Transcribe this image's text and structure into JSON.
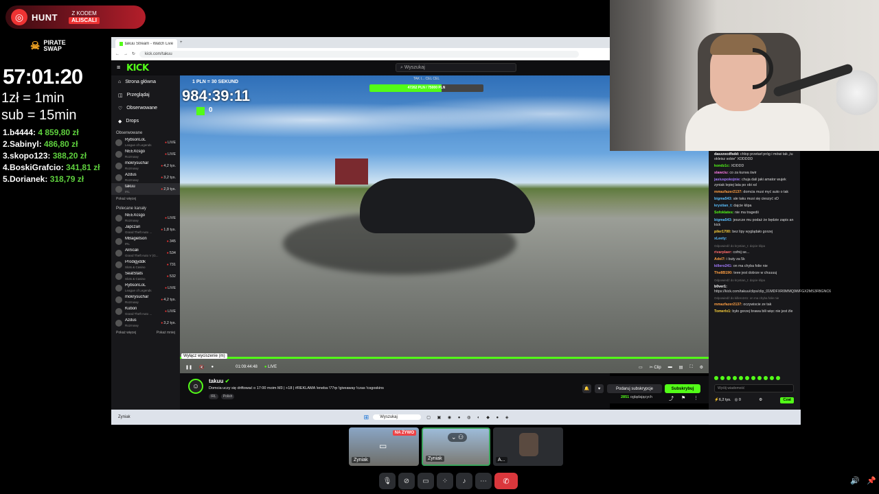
{
  "overlay": {
    "sponsor": {
      "brand": "HUNT",
      "code_label": "Z KODEM",
      "code": "ALISCALI"
    },
    "pirate_brand": "PIRATE SWAP",
    "timer": "57:01:20",
    "rate1": "1zł = 1min",
    "rate2": "sub = 15min",
    "leaderboard": [
      {
        "name": "1.b4444:",
        "amount": "4 859,80 zł"
      },
      {
        "name": "2.Sabinyl:",
        "amount": "486,80 zł"
      },
      {
        "name": "3.skopo123:",
        "amount": "388,20 zł"
      },
      {
        "name": "4.BoskiGrafcio:",
        "amount": "341,81 zł"
      },
      {
        "name": "5.Dorianek:",
        "amount": "318,79 zł"
      }
    ]
  },
  "browser": {
    "tab_title": "takuu Stream - Watch Live on Kick",
    "url": "kick.com/takuu",
    "logo": "KICK",
    "search_placeholder": "Wyszukaj",
    "nav": [
      {
        "icon": "home-icon",
        "label": "Strona główna"
      },
      {
        "icon": "browse-icon",
        "label": "Przeglądaj"
      },
      {
        "icon": "heart-icon",
        "label": "Obserwowane"
      },
      {
        "icon": "drops-icon",
        "label": "Drops"
      }
    ],
    "followed_header": "Obserwowane",
    "followed": [
      {
        "name": "RybsonLoL",
        "cat": "League of Legends",
        "viewers": "LIVE"
      },
      {
        "name": "NEEXcsgo",
        "cat": "Rozmowy",
        "viewers": "LIVE"
      },
      {
        "name": "mokrysuchar",
        "cat": "Rozmowy",
        "viewers": "4,2 tys."
      },
      {
        "name": "Azdus",
        "cat": "Rozmowy",
        "viewers": "3,2 tys."
      },
      {
        "name": "takuu",
        "cat": "IRL",
        "viewers": "2,9 tys."
      }
    ],
    "show_more": "Pokaż więcej",
    "recommended_header": "Polecane kanały",
    "recommended": [
      {
        "name": "NEEXcsgo",
        "cat": "Rozmowy",
        "viewers": "LIVE"
      },
      {
        "name": "Japczan",
        "cat": "Grand Theft Auto ...",
        "viewers": "1,8 tys."
      },
      {
        "name": "MBagietson",
        "cat": "IRL",
        "viewers": "345"
      },
      {
        "name": "AliScali",
        "cat": "Grand Theft Auto V (G...",
        "viewers": "534"
      },
      {
        "name": "Prodigyddk",
        "cat": "Slots & Casino",
        "viewers": "731"
      },
      {
        "name": "SeatStats",
        "cat": "Slots & Casino",
        "viewers": "532"
      },
      {
        "name": "RybsonLoL",
        "cat": "League of Legends",
        "viewers": "LIVE"
      },
      {
        "name": "mokrysuchar",
        "cat": "Rozmowy",
        "viewers": "4,2 tys."
      },
      {
        "name": "Kubon",
        "cat": "Grand Theft Auto ...",
        "viewers": "LIVE"
      },
      {
        "name": "Azdus",
        "cat": "Rozmowy",
        "viewers": "3,2 tys."
      }
    ],
    "show_more2": "Pokaż więcej",
    "show_less": "Pokaż mniej"
  },
  "video": {
    "pln_label": "1 PLN = 30 SEKUND",
    "big_timer": "984:39:11",
    "goal_header": "TAK I... CEL CEL",
    "goal_text": "47262 PLN / 75000 PLN",
    "goal_progress": 0.63,
    "green_counter": "0",
    "tooltip": "Wyłącz wyciszenie (m)",
    "elapsed": "01:09:44:48",
    "live_label": "LIVE",
    "clip_label": "Clip"
  },
  "stream": {
    "name": "takuu",
    "title": "Domcia uczy się driftować o 17:00 moim M3 | +18 | #REKLAMA !eneba !77rp !giveaway !czas !csgoskins",
    "tags": [
      "IRL",
      "Polish"
    ],
    "gift_label": "Podaruj subskrypcje",
    "subscribe_label": "Subskrybuj",
    "viewers_count": "2851",
    "viewers_label": "oglądających",
    "live_badge": "LIVE"
  },
  "chat": {
    "messages": [
      {
        "user": "daszzxcdfsdd:",
        "text": "chłop przetarł próg i mówi tak „tu okleisz sobie” XDDDDD",
        "color": "#ffffff"
      },
      {
        "user": "kondz1c:",
        "text": "XDDDD",
        "color": "#53fc18"
      },
      {
        "user": "slawciu:",
        "text": "co za kurwa świr",
        "color": "#ff7de9"
      },
      {
        "user": "jasiuspokojnie:",
        "text": "chuja dali jaki amator wujek zyniak lepiej lata po obi xd",
        "color": "#a57cff"
      },
      {
        "user": "mmazfazer2137:",
        "text": "domcia musi myć auto o tak",
        "color": "#ff9f43"
      },
      {
        "user": "bigma543:",
        "text": "ale taku musi się cieszyć xD",
        "color": "#5bc0ff"
      },
      {
        "user": "krystian_t:",
        "text": "dajcie klipa",
        "color": "#5bc0ff"
      },
      {
        "user": "Sofoklates:",
        "text": "nie ma tragedii",
        "color": "#53fc18"
      },
      {
        "user": "bigma543:",
        "text": "jeszcze mu podaż że będzie zapis an kick",
        "color": "#5bc0ff"
      },
      {
        "user": "piler1700:",
        "text": "bez lipy wyglądało gorzej",
        "color": "#ffd43b"
      },
      {
        "user": "xLeety:",
        "text": "",
        "color": "#5bc0ff"
      },
      {
        "user": "rivarplaer:",
        "text": "cofnij se...",
        "color": "#ff6b6b",
        "reply": "Odpowiedź do krystian_t: dajcie klipa"
      },
      {
        "user": "Adol7:",
        "text": "i buty za 5k",
        "color": "#ff9f43"
      },
      {
        "user": "killero241:",
        "text": "on ma chyba folie nie",
        "color": "#a57cff"
      },
      {
        "user": "The8B190:",
        "text": "teee jest dobrze w chuuuuj",
        "color": "#ff9f43"
      },
      {
        "user": "b0ver1:",
        "text": "https://kick.com/takuu/clips/clip_01MDFXR0MMQ9WFGX2MS3FBGNC6",
        "color": "#ffffff",
        "reply": "Odpowiedź do krystian_t: dajcie klipa"
      },
      {
        "user": "mmazfazer2137:",
        "text": "oczywiscie ze tak",
        "color": "#ff9f43",
        "reply": "Odpowiedź do killero241: on ma chyba folie nie"
      },
      {
        "user": "Tomerlx1:",
        "text": "było gorzej brawa bili więc nie jest źle",
        "color": "#ffd43b"
      }
    ],
    "input_placeholder": "Wyślij wiadomość",
    "points": "6,2 tys.",
    "zero": "0",
    "send_label": "Czat"
  },
  "taskbar": {
    "left_label": "Zyniak",
    "search_placeholder": "Wyszukaj"
  },
  "discord": {
    "tile1_label": "Zyniak",
    "tile1_badge": "NA ŻYWO",
    "tile2_label": "Zyniak",
    "tile3_label": "A..."
  }
}
